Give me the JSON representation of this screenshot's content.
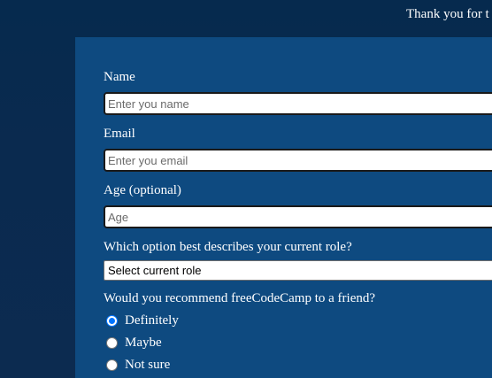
{
  "intro_text": "Thank you for t",
  "form": {
    "name": {
      "label": "Name",
      "placeholder": "Enter you name"
    },
    "email": {
      "label": "Email",
      "placeholder": "Enter you email"
    },
    "age": {
      "label": "Age (optional)",
      "placeholder": "Age"
    },
    "role": {
      "label": "Which option best describes your current role?",
      "selected": "Select current role"
    },
    "recommend": {
      "label": "Would you recommend freeCodeCamp to a friend?",
      "options": [
        {
          "label": "Definitely",
          "checked": true
        },
        {
          "label": "Maybe",
          "checked": false
        },
        {
          "label": "Not sure",
          "checked": false
        }
      ]
    }
  }
}
